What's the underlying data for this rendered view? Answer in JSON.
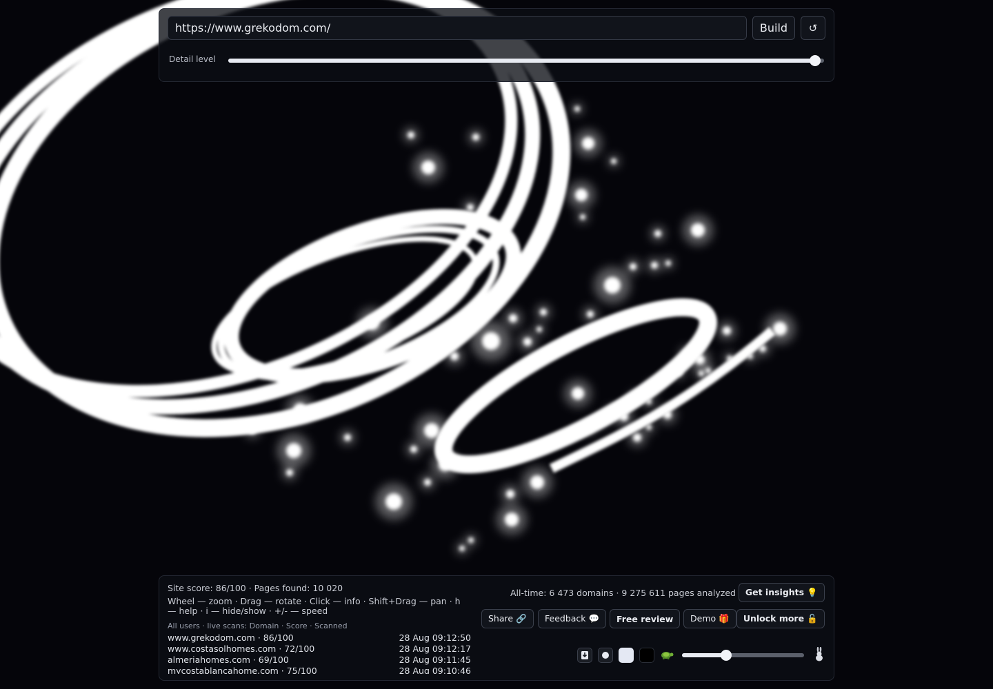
{
  "toolbar": {
    "url_value": "https://www.grekodom.com/",
    "build_label": "Build",
    "reset_label": "↺",
    "detail_label": "Detail level",
    "detail_level": 0.985
  },
  "stats": {
    "site_score_line": "Site score: 86/100 · Pages found: 10 020",
    "help_text": "Wheel — zoom · Drag — rotate · Click — info · Shift+Drag — pan · h — help · i — hide/show · +/- — speed",
    "scans_header": "All users · live scans: Domain · Score · Scanned",
    "scans": [
      {
        "domain": "www.grekodom.com · 86/100",
        "time": "28 Aug 09:12:50"
      },
      {
        "domain": "www.costasolhomes.com · 72/100",
        "time": "28 Aug 09:12:17"
      },
      {
        "domain": "almeriahomes.com · 69/100",
        "time": "28 Aug 09:11:45"
      },
      {
        "domain": "mycostablancahome.com · 75/100",
        "time": "28 Aug 09:10:46"
      }
    ],
    "alltime": "All-time: 6 473 domains · 9 275 611 pages analyzed"
  },
  "actions": {
    "insights": "Get insights 💡",
    "share": "Share 🔗",
    "feedback": "Feedback 💬",
    "free_review": "Free review",
    "demo": "Demo 🎁",
    "unlock": "Unlock more 🔓"
  },
  "controls": {
    "speed_level": 0.36,
    "icons": [
      "download-icon",
      "small-dot-icon",
      "large-dot-icon",
      "dark-background-icon",
      "turtle-icon",
      "rabbit-icon"
    ]
  }
}
